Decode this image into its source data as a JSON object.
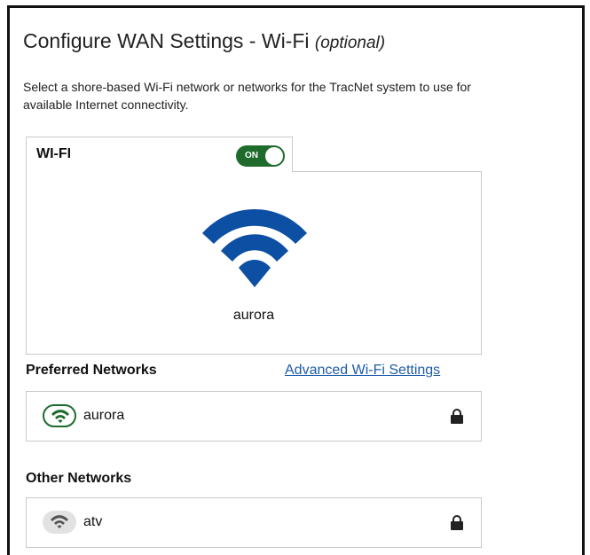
{
  "header": {
    "title": "Configure WAN Settings - Wi-Fi",
    "title_optional": "(optional)",
    "description": "Select a shore-based Wi-Fi network or networks for the TracNet system to use for available Internet connectivity."
  },
  "wifi_tab": {
    "label": "WI-FI",
    "toggle_label": "ON",
    "toggle_on": true
  },
  "status": {
    "connected_ssid": "aurora",
    "icon": "wifi-icon",
    "icon_color": "#0d4fa3"
  },
  "preferred": {
    "title": "Preferred Networks",
    "advanced_link": "Advanced Wi-Fi Settings",
    "networks": [
      {
        "name": "aurora",
        "icon": "wifi-icon",
        "secured": true,
        "icon_color": "#1e6b2c"
      }
    ]
  },
  "other": {
    "title": "Other Networks",
    "networks": [
      {
        "name": "atv",
        "icon": "wifi-icon",
        "secured": true,
        "icon_color": "#555555"
      }
    ]
  },
  "colors": {
    "toggle_on": "#1e6b2c",
    "link": "#1d5ba8"
  }
}
